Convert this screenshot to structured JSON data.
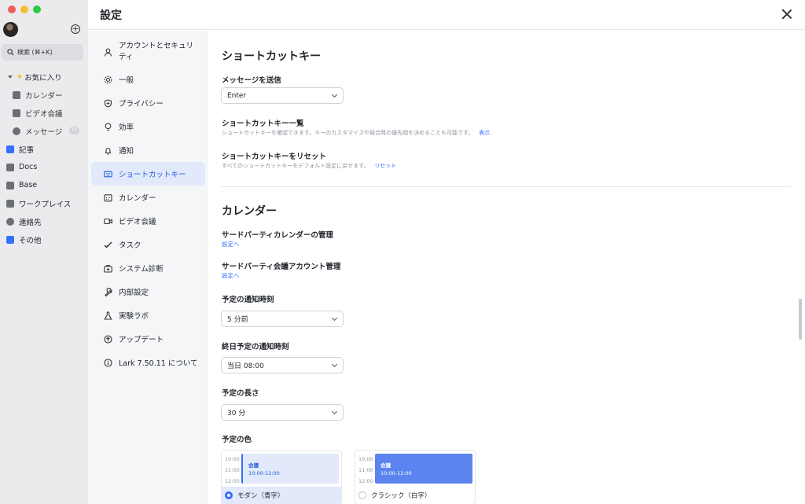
{
  "sidebar": {
    "search_label": "検索 (⌘+K)",
    "favorites_label": "お気に入り",
    "items": [
      {
        "label": "カレンダー"
      },
      {
        "label": "ビデオ会議"
      },
      {
        "label": "メッセージ",
        "badge": "32"
      },
      {
        "label": "記事"
      },
      {
        "label": "Docs"
      },
      {
        "label": "Base"
      },
      {
        "label": "ワークプレイス"
      },
      {
        "label": "連絡先"
      },
      {
        "label": "その他"
      }
    ]
  },
  "panel": {
    "title": "設定"
  },
  "settings_nav": [
    {
      "label": "アカウントとセキュリティ",
      "icon": "person-icon"
    },
    {
      "label": "一般",
      "icon": "gear-icon"
    },
    {
      "label": "プライバシー",
      "icon": "shield-icon"
    },
    {
      "label": "効率",
      "icon": "lightbulb-icon"
    },
    {
      "label": "通知",
      "icon": "bell-icon"
    },
    {
      "label": "ショートカットキー",
      "icon": "keyboard-icon",
      "active": true
    },
    {
      "label": "カレンダー",
      "icon": "calendar-icon"
    },
    {
      "label": "ビデオ会議",
      "icon": "video-icon"
    },
    {
      "label": "タスク",
      "icon": "check-icon"
    },
    {
      "label": "システム診断",
      "icon": "medkit-icon"
    },
    {
      "label": "内部設定",
      "icon": "wrench-icon"
    },
    {
      "label": "実験ラボ",
      "icon": "flask-icon"
    },
    {
      "label": "アップデート",
      "icon": "upload-icon"
    },
    {
      "label": "Lark 7.50.11 について",
      "icon": "info-icon"
    }
  ],
  "shortcuts": {
    "title": "ショートカットキー",
    "send_label": "メッセージを送信",
    "send_value": "Enter",
    "list_label": "ショートカットキー一覧",
    "list_desc": "ショートカットキーを確認できます。キーのカスタマイズや競合時の優先順を決めることも可能です。",
    "list_link": "表示",
    "reset_label": "ショートカットキーをリセット",
    "reset_desc": "すべてのショートカットキーをデフォルト設定に戻せます。",
    "reset_link": "リセット"
  },
  "calendar": {
    "title": "カレンダー",
    "third_party_cal_label": "サードパーティカレンダーの管理",
    "third_party_cal_link": "設定へ",
    "third_party_meeting_label": "サードパーティ会議アカウント管理",
    "third_party_meeting_link": "設定へ",
    "notify_label": "予定の通知時刻",
    "notify_value": "5 分前",
    "allday_label": "終日予定の通知時刻",
    "allday_value": "当日 08:00",
    "length_label": "予定の長さ",
    "length_value": "30 分",
    "color_label": "予定の色",
    "times": [
      "10:00",
      "11:00",
      "12:00"
    ],
    "event_name": "会議",
    "event_time": "10:00-12:00",
    "modern_label": "モダン（青字）",
    "classic_label": "クラシック（白字）"
  },
  "colors": {
    "accent": "#3370ff",
    "active_bg": "#e1e9fb",
    "modern_event": "#e1e9fb",
    "classic_event": "#5b84f0"
  }
}
